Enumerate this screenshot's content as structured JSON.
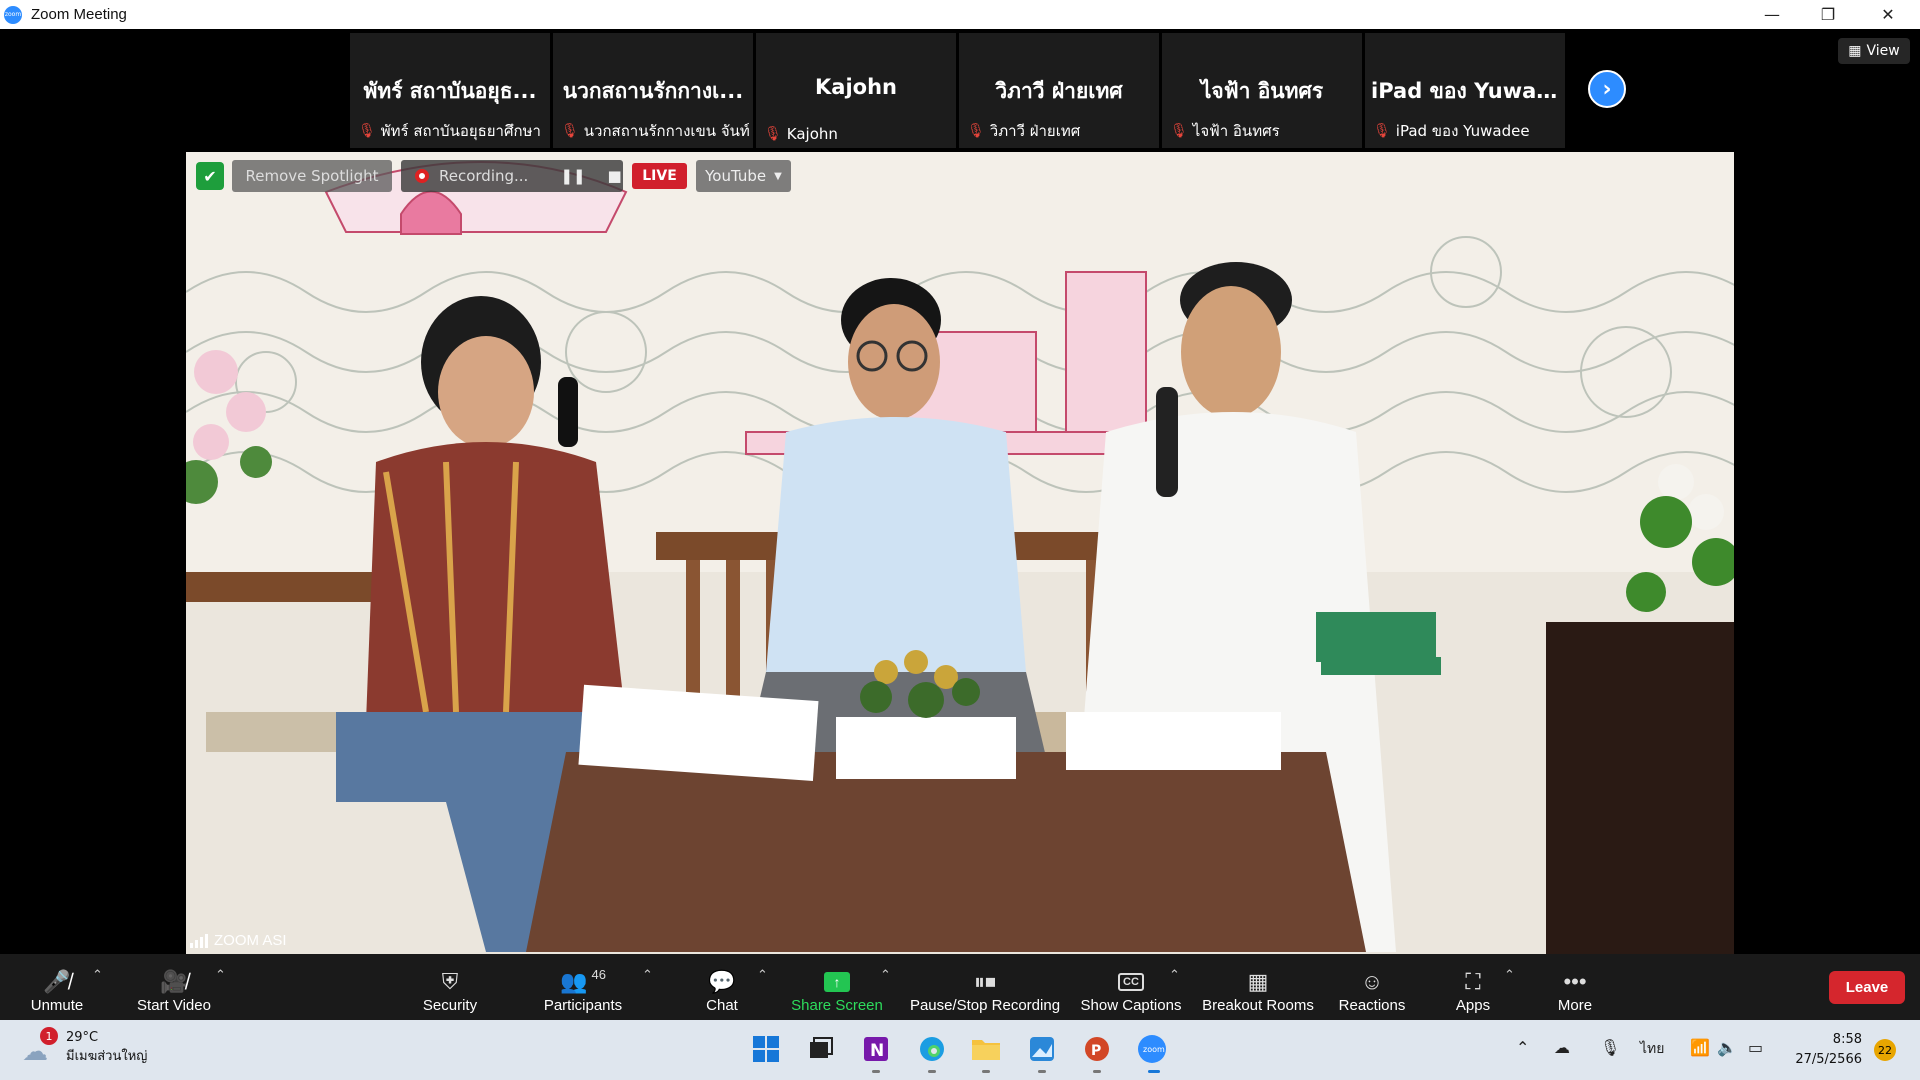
{
  "window": {
    "title": "Zoom Meeting",
    "minimize": "—",
    "restore": "❐",
    "close": "✕"
  },
  "gallery": {
    "tiles": [
      {
        "display_name": "พัทร์ สถาบันอยุธ...",
        "name_label": "พัทร์ สถาบันอยุธยาศึกษา"
      },
      {
        "display_name": "นวกสถานรักกางเ...",
        "name_label": "นวกสถานรักกางเขน จันท์..."
      },
      {
        "display_name": "Kajohn",
        "name_label": "Kajohn"
      },
      {
        "display_name": "วิภาวี ฝ่ายเทศ",
        "name_label": "วิภาวี ฝ่ายเทศ"
      },
      {
        "display_name": "ไจฟ้า อินทศร",
        "name_label": "ไจฟ้า อินทศร"
      },
      {
        "display_name": "iPad ของ Yuwad...",
        "name_label": "iPad ของ Yuwadee"
      }
    ],
    "next_icon": "chevron-right",
    "view_label": "View"
  },
  "video_overlay": {
    "remove_spotlight": "Remove Spotlight",
    "recording": "Recording...",
    "live": "LIVE",
    "youtube": "YouTube",
    "speaker_name": "ZOOM ASI",
    "colors": {
      "live": "#d11f2c",
      "secure": "#1e9e3c"
    }
  },
  "toolbar": {
    "unmute": "Unmute",
    "start_video": "Start Video",
    "security": "Security",
    "participants": "Participants",
    "participant_count": "46",
    "chat": "Chat",
    "share_screen": "Share Screen",
    "pause_stop_recording": "Pause/Stop Recording",
    "show_captions": "Show Captions",
    "breakout_rooms": "Breakout Rooms",
    "reactions": "Reactions",
    "apps": "Apps",
    "more": "More",
    "leave": "Leave",
    "colors": {
      "leave": "#d5262d",
      "share": "#2ddc5c"
    }
  },
  "taskbar": {
    "weather_temp": "29°C",
    "weather_desc": "มีเมฆส่วนใหญ่",
    "weather_badge": "1",
    "language": "ไทย",
    "time": "8:58",
    "date": "27/5/2566",
    "notifications": "22",
    "apps": [
      "windows-start",
      "task-view",
      "onenote",
      "edge",
      "file-explorer",
      "photos",
      "powerpoint",
      "zoom"
    ]
  }
}
